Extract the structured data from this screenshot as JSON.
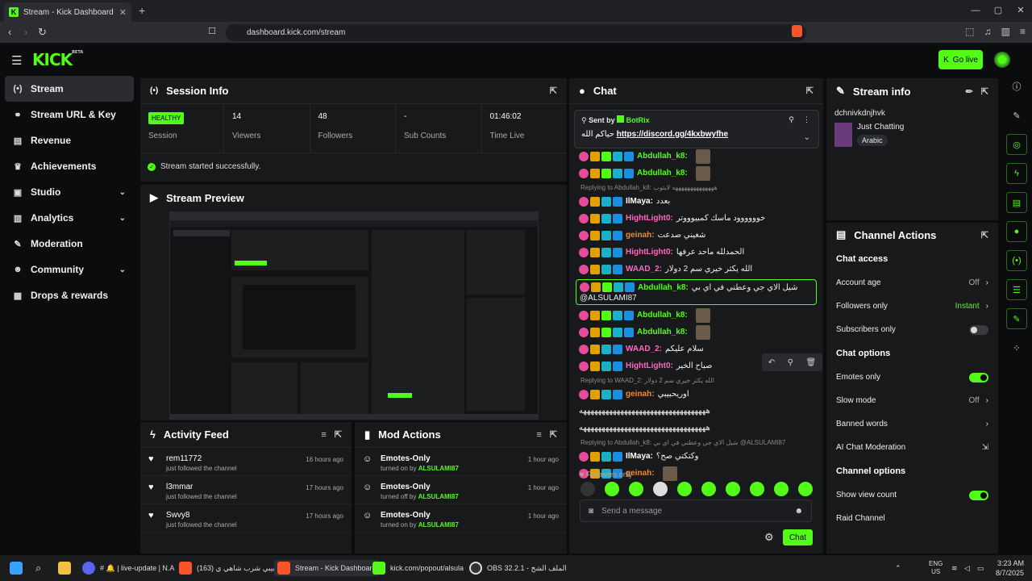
{
  "browser": {
    "tab_title": "Stream - Kick Dashboard",
    "url": "dashboard.kick.com/stream"
  },
  "header": {
    "logo": "KICK",
    "logo_beta": "BETA",
    "go_live": "Go live"
  },
  "sidebar": {
    "items": [
      {
        "label": "Stream",
        "icon": "broadcast-icon"
      },
      {
        "label": "Stream URL & Key",
        "icon": "link-icon"
      },
      {
        "label": "Revenue",
        "icon": "chart-icon"
      },
      {
        "label": "Achievements",
        "icon": "trophy-icon"
      },
      {
        "label": "Studio",
        "icon": "studio-icon"
      },
      {
        "label": "Analytics",
        "icon": "analytics-icon"
      },
      {
        "label": "Moderation",
        "icon": "wrench-icon"
      },
      {
        "label": "Community",
        "icon": "people-icon"
      },
      {
        "label": "Drops & rewards",
        "icon": "gift-icon"
      }
    ]
  },
  "session": {
    "title": "Session Info",
    "badge": "HEALTHY",
    "session_label": "Session",
    "stats": [
      {
        "value": "14",
        "label": "Viewers"
      },
      {
        "value": "48",
        "label": "Followers"
      },
      {
        "value": "-",
        "label": "Sub Counts"
      },
      {
        "value": "01:46:02",
        "label": "Time Live"
      }
    ],
    "status": "Stream started successfully."
  },
  "preview": {
    "title": "Stream Preview"
  },
  "activity": {
    "title": "Activity Feed",
    "rows": [
      {
        "name": "rem11772",
        "sub": "just followed the channel",
        "time": "16 hours ago"
      },
      {
        "name": "l3mmar",
        "sub": "just followed the channel",
        "time": "17 hours ago"
      },
      {
        "name": "Swvy8",
        "sub": "just followed the channel",
        "time": "17 hours ago"
      }
    ]
  },
  "mod": {
    "title": "Mod Actions",
    "rows": [
      {
        "name": "Emotes-Only",
        "pre": "turned on by",
        "by": "ALSULAMI87",
        "time": "1 hour ago"
      },
      {
        "name": "Emotes-Only",
        "pre": "turned off by",
        "by": "ALSULAMI87",
        "time": "1 hour ago"
      },
      {
        "name": "Emotes-Only",
        "pre": "turned on by",
        "by": "ALSULAMI87",
        "time": "1 hour ago"
      }
    ]
  },
  "chat": {
    "title": "Chat",
    "pinned": {
      "sent_by": "Sent by",
      "bot": "BotRix",
      "text_prefix": "حياكم الله",
      "link": "https://discord.gg/4kxbwyfhe"
    },
    "messages": [
      {
        "type": "msg",
        "user": "Abdullah_k8:",
        "color": "g",
        "text": ""
      },
      {
        "type": "msg",
        "user": "Abdullah_k8:",
        "color": "g",
        "text": ""
      },
      {
        "type": "reply",
        "text": "Replying to Abdullah_k8: ههههههههههههههه لايتوب"
      },
      {
        "type": "msg",
        "user": "IlMaya:",
        "color": "w",
        "text": "بعدد"
      },
      {
        "type": "msg",
        "user": "HightLight0:",
        "color": "p",
        "text": "خوووووود ماسك كمبيوووتر"
      },
      {
        "type": "msg",
        "user": "geinah:",
        "color": "o",
        "text": "شغيني صدعت"
      },
      {
        "type": "msg",
        "user": "HightLight0:",
        "color": "p",
        "text": "الحمدلله ماحد عرفها"
      },
      {
        "type": "msg",
        "user": "WAAD_2:",
        "color": "p",
        "text": "الله يكثر خيري سم 2 دولار"
      },
      {
        "type": "hilite",
        "user": "Abdullah_k8:",
        "color": "g",
        "text": "شيل الاي جي وعطني في اي بي",
        "text2": "@ALSULAMI87"
      },
      {
        "type": "msg",
        "user": "Abdullah_k8:",
        "color": "g",
        "text": ""
      },
      {
        "type": "msg",
        "user": "Abdullah_k8:",
        "color": "g",
        "text": ""
      },
      {
        "type": "msg",
        "user": "WAAD_2:",
        "color": "p",
        "text": "سلام عليكم"
      },
      {
        "type": "msg",
        "user": "HightLight0:",
        "color": "p",
        "text": "صباح الخير"
      },
      {
        "type": "reply",
        "text": "Replying to WAAD_2: الله يكثر خيري سم 2 دولار"
      },
      {
        "type": "msg",
        "user": "geinah:",
        "color": "o",
        "text": "اوريحبيبي"
      },
      {
        "type": "plain",
        "text": "ههههههههههههههههههههههههههههههههههه"
      },
      {
        "type": "plain",
        "text": "ههههههههههههههههههههههههههههههههههه"
      },
      {
        "type": "reply",
        "text": "Replying to Abdullah_k8: شيل الاي جي وعطني في اي بي @ALSULAMI87"
      },
      {
        "type": "msg",
        "user": "IlMaya:",
        "color": "w",
        "text": "وكتكتي صح؟"
      },
      {
        "type": "msg",
        "user": "geinah:",
        "color": "o",
        "text": ""
      }
    ],
    "followers_only": "Followers only",
    "placeholder": "Send a message",
    "send": "Chat"
  },
  "streaminfo": {
    "title": "Stream info",
    "channel": "dchnivkdnjhvk",
    "category": "Just Chatting",
    "tag": "Arabic"
  },
  "channel_actions": {
    "title": "Channel Actions",
    "chat_access": "Chat access",
    "account_age": "Account age",
    "account_age_val": "Off",
    "followers_only": "Followers only",
    "followers_only_val": "Instant",
    "subscribers_only": "Subscribers only",
    "chat_options": "Chat options",
    "emotes_only": "Emotes only",
    "slow_mode": "Slow mode",
    "slow_mode_val": "Off",
    "banned_words": "Banned words",
    "ai_mod": "AI Chat Moderation",
    "channel_options": "Channel options",
    "show_view_count": "Show view count",
    "raid": "Raid Channel"
  },
  "taskbar": {
    "items": [
      "# 🔔 | live-update | N.A",
      "(163) حبيبي شرب شاهي ي",
      "Stream - Kick Dashboard",
      "kick.com/popout/alsula",
      "OBS 32.2.1 - الملف الشخ"
    ],
    "lang": "ENG",
    "region": "US",
    "time": "3:23 AM",
    "date": "8/7/2025"
  }
}
